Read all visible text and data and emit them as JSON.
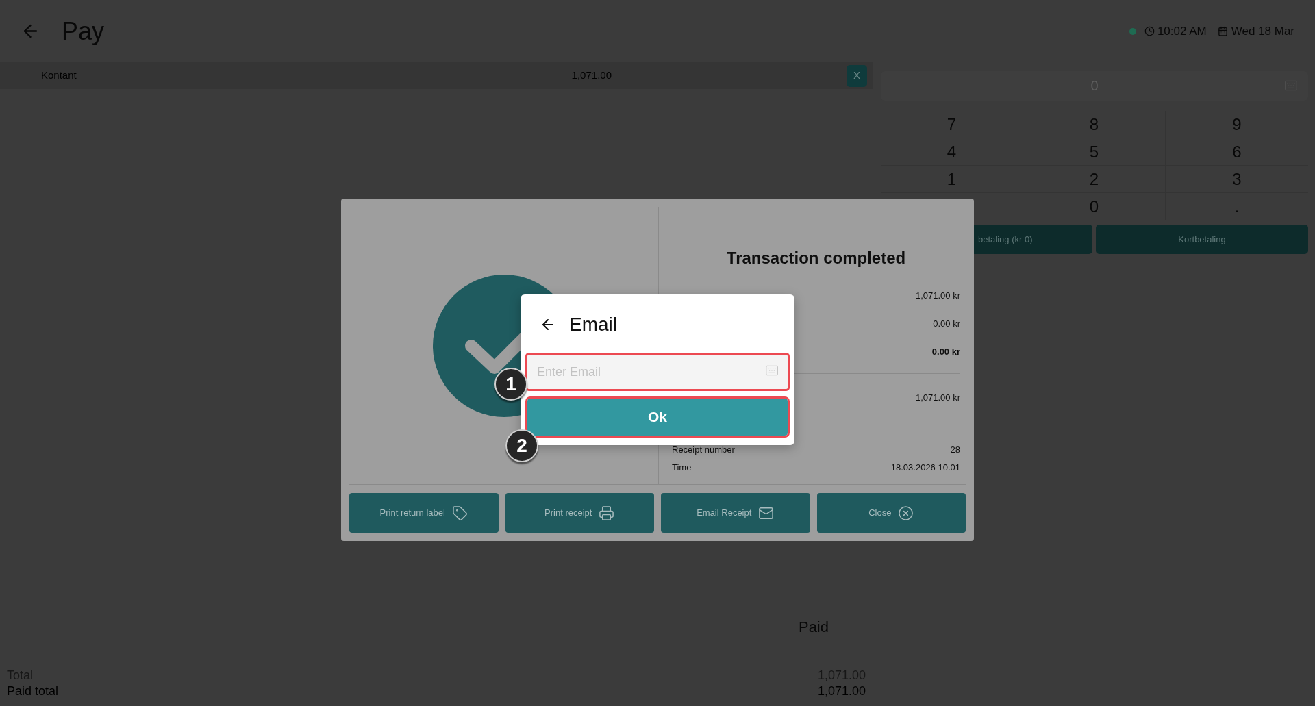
{
  "header": {
    "title": "Pay",
    "status": {
      "online": true
    },
    "time": "10:02 AM",
    "date": "Wed 18 Mar"
  },
  "payments": [
    {
      "method": "Kontant",
      "amount": "1,071.00",
      "remove_label": "X"
    }
  ],
  "keypad": {
    "amount_field": {
      "placeholder": "0"
    },
    "rows": [
      [
        "7",
        "8",
        "9"
      ],
      [
        "4",
        "5",
        "6"
      ],
      [
        "1",
        "2",
        "3"
      ],
      [
        "",
        "0",
        "."
      ]
    ],
    "buttons": [
      {
        "label": "betaling (kr 0)"
      },
      {
        "label": "Kortbetaling"
      }
    ]
  },
  "summary": {
    "heading": "Paid",
    "rows": [
      {
        "label": "Total",
        "value": "1,071.00",
        "muted": true
      },
      {
        "label": "Paid total",
        "value": "1,071.00",
        "muted": false
      }
    ]
  },
  "transaction_dialog": {
    "title": "Transaction completed",
    "amounts": [
      {
        "value": "1,071.00 kr",
        "bold": false
      },
      {
        "value": "0.00 kr",
        "bold": false
      },
      {
        "value": "0.00 kr",
        "bold": true
      }
    ],
    "after_divider": [
      {
        "value": "1,071.00 kr"
      }
    ],
    "receipt_info": [
      {
        "label": "Receipt number",
        "value": "28"
      },
      {
        "label": "Time",
        "value": "18.03.2026 10.01"
      }
    ],
    "actions": [
      {
        "label": "Print return label",
        "kind": "tag"
      },
      {
        "label": "Print receipt",
        "kind": "print"
      },
      {
        "label": "Email Receipt",
        "kind": "email"
      },
      {
        "label": "Close",
        "kind": "close"
      }
    ]
  },
  "email_dialog": {
    "title": "Email",
    "input": {
      "placeholder": "Enter Email",
      "highlighted": true
    },
    "ok_button": {
      "label": "Ok",
      "highlighted": true
    }
  },
  "annotations": [
    {
      "label": "1"
    },
    {
      "label": "2"
    }
  ]
}
